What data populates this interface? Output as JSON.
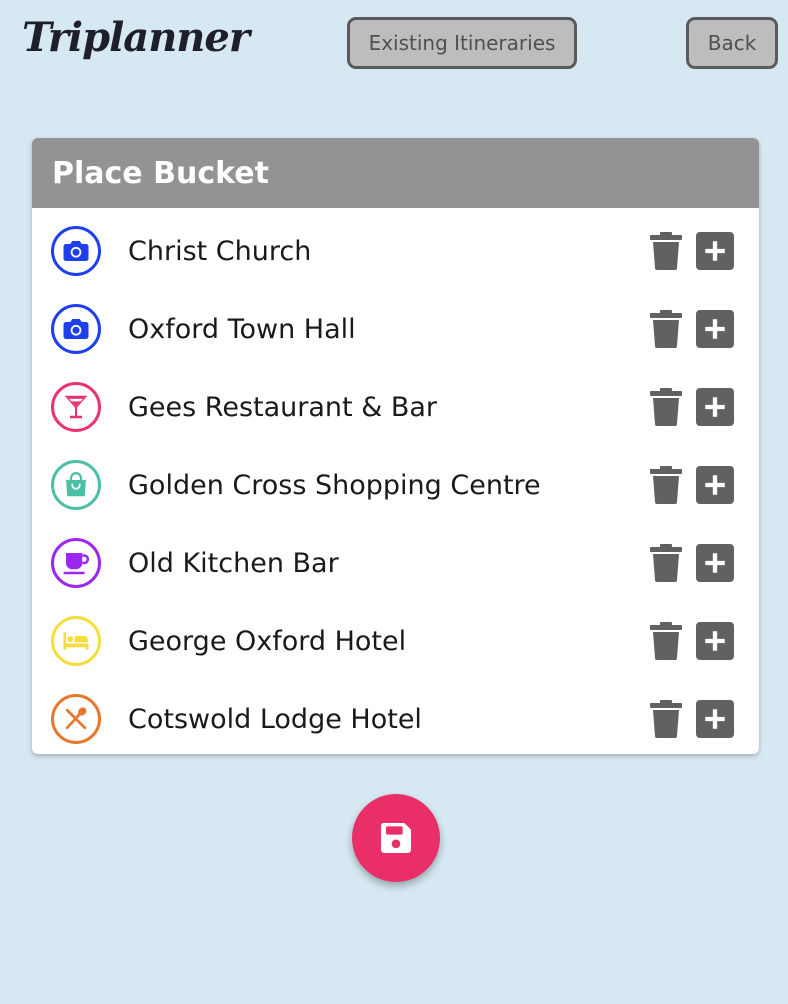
{
  "app": {
    "logo_text": "Triplanner"
  },
  "nav": {
    "existing_label": "Existing Itineraries",
    "back_label": "Back"
  },
  "bucket": {
    "title": "Place Bucket",
    "items": [
      {
        "name": "Christ Church",
        "icon": "camera-icon",
        "color": "#1e3ff0"
      },
      {
        "name": "Oxford Town Hall",
        "icon": "camera-icon",
        "color": "#1e3ff0"
      },
      {
        "name": "Gees Restaurant & Bar",
        "icon": "cocktail-icon",
        "color": "#e8356b"
      },
      {
        "name": "Golden Cross Shopping Centre",
        "icon": "shopping-bag-icon",
        "color": "#4cbfa6"
      },
      {
        "name": "Old Kitchen Bar",
        "icon": "coffee-cup-icon",
        "color": "#9b27f0"
      },
      {
        "name": "George Oxford Hotel",
        "icon": "bed-icon",
        "color": "#f5dd3a"
      },
      {
        "name": "Cotswold Lodge Hotel",
        "icon": "utensils-icon",
        "color": "#e8772e"
      }
    ]
  },
  "actions": {
    "save_icon": "save-icon",
    "save_color": "#ea2e68",
    "delete_icon": "trash-icon",
    "add_icon": "plus-icon"
  }
}
